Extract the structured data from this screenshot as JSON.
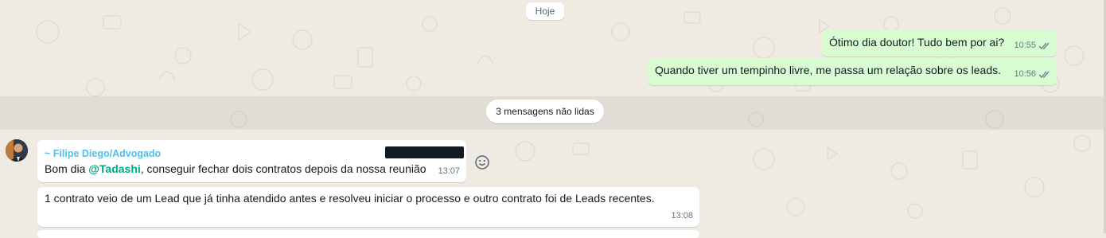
{
  "chat": {
    "date_label": "Hoje",
    "outgoing": [
      {
        "text": "Ótimo dia doutor! Tudo bem por ai?",
        "time": "10:55",
        "status_icon": "double-check-icon"
      },
      {
        "text": "Quando tiver um tempinho livre, me passa um relação sobre os leads.",
        "time": "10:56",
        "status_icon": "double-check-icon"
      }
    ],
    "unread_label": "3 mensagens não lidas",
    "incoming": [
      {
        "sender": "~ Filipe Diego/Advogado",
        "text_before": "Bom dia ",
        "mention": "@Tadashi",
        "text_after": ", conseguir fechar dois contratos depois da nossa reunião",
        "time": "13:07"
      },
      {
        "text": "1 contrato veio de um Lead que já tinha atendido antes e resolveu iniciar o processo e outro contrato foi de Leads recentes.",
        "time": "13:08"
      }
    ]
  },
  "icons": {
    "tick": "double-check-icon",
    "react": "smiley-react-icon",
    "avatar": "contact-avatar"
  },
  "colors": {
    "background": "#efeae2",
    "outgoing_bubble": "#d9fdd3",
    "incoming_bubble": "#ffffff",
    "sender_name": "#53bdeb",
    "mention": "#00a884",
    "tick": "#667781"
  }
}
